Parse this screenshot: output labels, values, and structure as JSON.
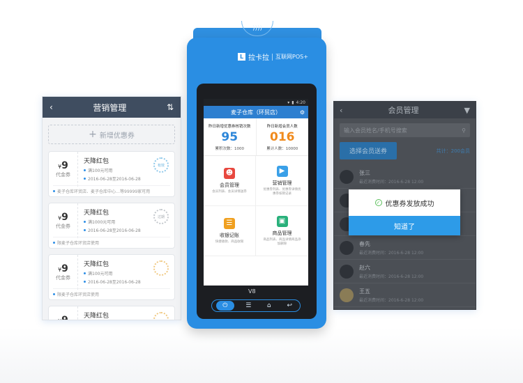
{
  "left_panel": {
    "title": "营销管理",
    "add_coupon": "新增优惠券",
    "coupons": [
      {
        "price": "9",
        "currency": "¥",
        "kind": "代金券",
        "name": "天降红包",
        "rule": "满100元可用",
        "validity": "2016-06-28至2016-06-28",
        "note": "麦子仓库环贸店、麦子仓库中心…等99999家可用",
        "stamp": "有效"
      },
      {
        "price": "9",
        "currency": "¥",
        "kind": "代金券",
        "name": "天降红包",
        "rule": "满1000元可用",
        "validity": "2016-06-28至2016-06-28",
        "note": "限麦子仓库环贸店使用",
        "stamp": "过期"
      },
      {
        "price": "9",
        "currency": "¥",
        "kind": "代金券",
        "name": "天降红包",
        "rule": "满100元可用",
        "validity": "2016-06-28至2016-06-28",
        "note": "限麦子仓库环贸店使用",
        "stamp": ""
      },
      {
        "price": "9",
        "currency": "¥",
        "kind": "代金券",
        "name": "天降红包",
        "rule": "",
        "validity": "",
        "note": "",
        "stamp": ""
      }
    ]
  },
  "right_panel": {
    "title": "会员管理",
    "search_placeholder": "输入会员姓名/手机号搜索",
    "select_button": "选择会员送券",
    "total": "共计：200会员",
    "members": [
      {
        "name": "张三",
        "sub": "最近消费时间：2016-6-28 12:00"
      },
      {
        "name": "",
        "sub": ""
      },
      {
        "name": "",
        "sub": ""
      },
      {
        "name": "春先",
        "sub": "最近消费时间：2016-6-28 12:00"
      },
      {
        "name": "赵六",
        "sub": "最近消费时间：2016-6-28 12:00"
      },
      {
        "name": "王五",
        "sub": "最近消费时间：2016-6-28 12:00"
      }
    ],
    "dialog": {
      "message": "优惠券发放成功",
      "confirm": "知道了"
    }
  },
  "device": {
    "brand": "拉卡拉",
    "brand_sub": "互联网POS+",
    "model": "V8",
    "screen": {
      "time": "4:20",
      "store": "麦子仓库（环贸店）",
      "stat1": {
        "label": "昨日新增优惠券核销次数",
        "value": "95",
        "total": "累积次数：1000"
      },
      "stat2": {
        "label": "昨日新增会员人数",
        "value": "016",
        "total": "累计人数：10000"
      },
      "tiles": [
        {
          "title": "会员管理",
          "desc": "会员列表、会员详情送券",
          "color": "#e8483f"
        },
        {
          "title": "营销管理",
          "desc": "优惠券列表、优惠券详情优惠券核销记录",
          "color": "#3aa0e8"
        },
        {
          "title": "收银记账",
          "desc": "快捷收款、商品收银",
          "color": "#f0a020"
        },
        {
          "title": "商品管理",
          "desc": "商品列表、商品详情商品添加删除",
          "color": "#28b07a"
        }
      ]
    }
  },
  "colors": {
    "accent": "#2a8ee3",
    "orange": "#f08a1c",
    "dark_header": "#3f4d60"
  }
}
